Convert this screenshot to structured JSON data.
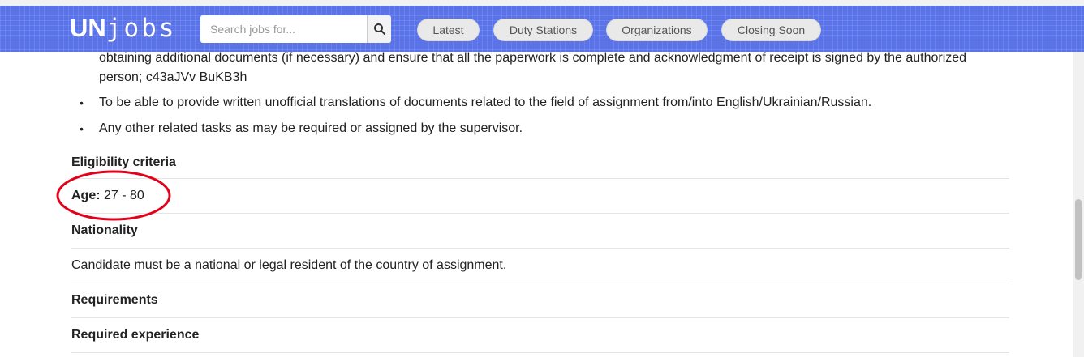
{
  "header": {
    "logo_bold": "UN",
    "logo_light": "jobs",
    "search_placeholder": "Search jobs for...",
    "search_icon": "search-icon",
    "nav": [
      "Latest",
      "Duty Stations",
      "Organizations",
      "Closing Soon"
    ],
    "accent_color": "#5a73e8"
  },
  "content": {
    "continued_text": "obtaining additional documents (if necessary) and ensure that all the paperwork is complete and acknowledgment of receipt is signed by the authorized person; c43aJVv BuKB3h",
    "bullets": [
      "To be able to provide written unofficial translations of documents related to the field of assignment from/into English/Ukrainian/Russian.",
      "Any other related tasks as may be required or assigned by the supervisor."
    ],
    "eligibility_heading": "Eligibility criteria",
    "age_label": "Age:",
    "age_value": "27 - 80",
    "nationality_heading": "Nationality",
    "nationality_text": "Candidate must be a national or legal resident of the country of assignment.",
    "requirements_heading": "Requirements",
    "required_experience_heading": "Required experience"
  },
  "annotation": {
    "color": "#e3001b"
  }
}
